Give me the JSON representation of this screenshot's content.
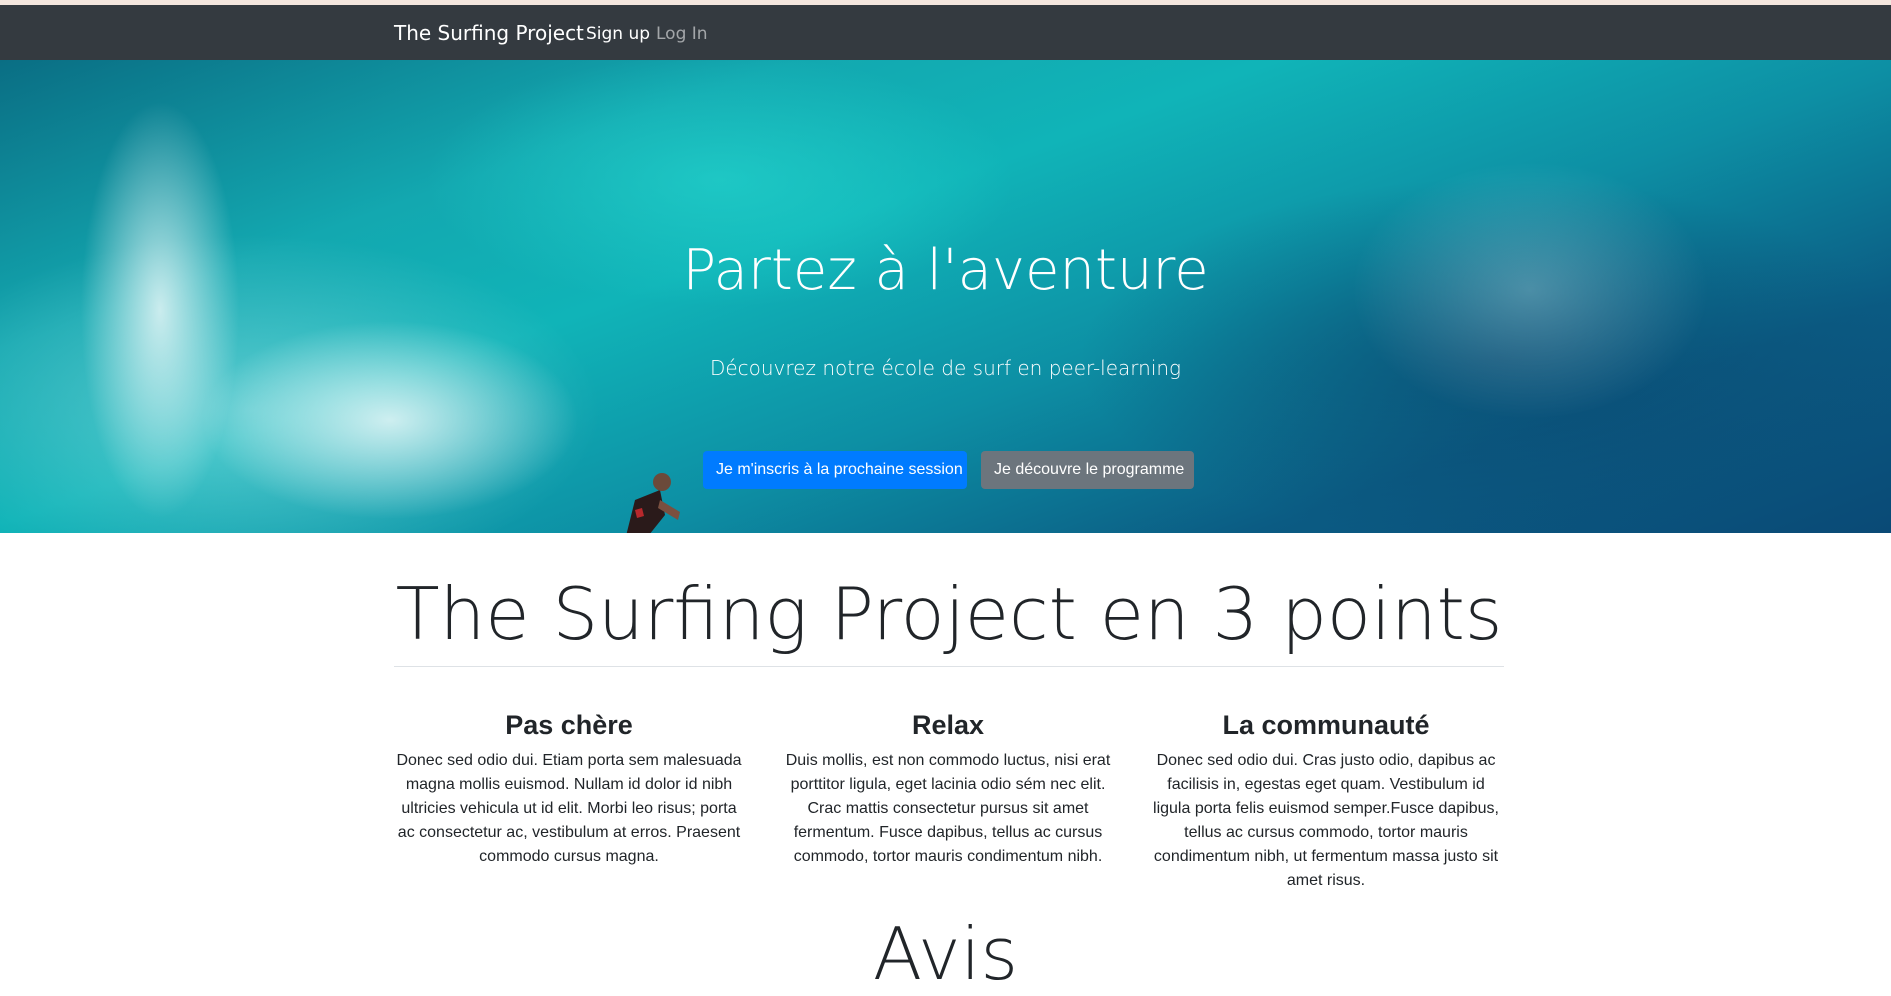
{
  "navbar": {
    "brand": "The Surfing Project",
    "links": [
      {
        "label": "Sign up",
        "active": true
      },
      {
        "label": "Log In",
        "active": false
      }
    ]
  },
  "hero": {
    "title": "Partez à l'aventure",
    "subtitle": "Découvrez notre école de surf en peer-learning",
    "primary_button": "Je m'inscris à la prochaine session",
    "secondary_button": "Je découvre le programme"
  },
  "points": {
    "title": "The Surfing Project en 3 points",
    "items": [
      {
        "heading": "Pas chère",
        "text": "Donec sed odio dui. Etiam porta sem malesuada magna mollis euismod. Nullam id dolor id nibh ultricies vehicula ut id elit. Morbi leo risus; porta ac consectetur ac, vestibulum at erros. Praesent commodo cursus magna."
      },
      {
        "heading": "Relax",
        "text": "Duis mollis, est non commodo luctus, nisi erat porttitor ligula, eget lacinia odio sém nec elit. Crac mattis consectetur pursus sit amet fermentum. Fusce dapibus, tellus ac cursus commodo, tortor mauris condimentum nibh."
      },
      {
        "heading": "La communauté",
        "text": "Donec sed odio dui. Cras justo odio, dapibus ac facilisis in, egestas eget quam. Vestibulum id ligula porta felis euismod semper.Fusce dapibus, tellus ac cursus commodo, tortor mauris condimentum nibh, ut fermentum massa justo sit amet risus."
      }
    ]
  },
  "reviews": {
    "title": "Avis"
  },
  "colors": {
    "navbar_bg": "#343a40",
    "primary": "#007bff",
    "secondary": "#6c757d",
    "text": "#212529"
  }
}
